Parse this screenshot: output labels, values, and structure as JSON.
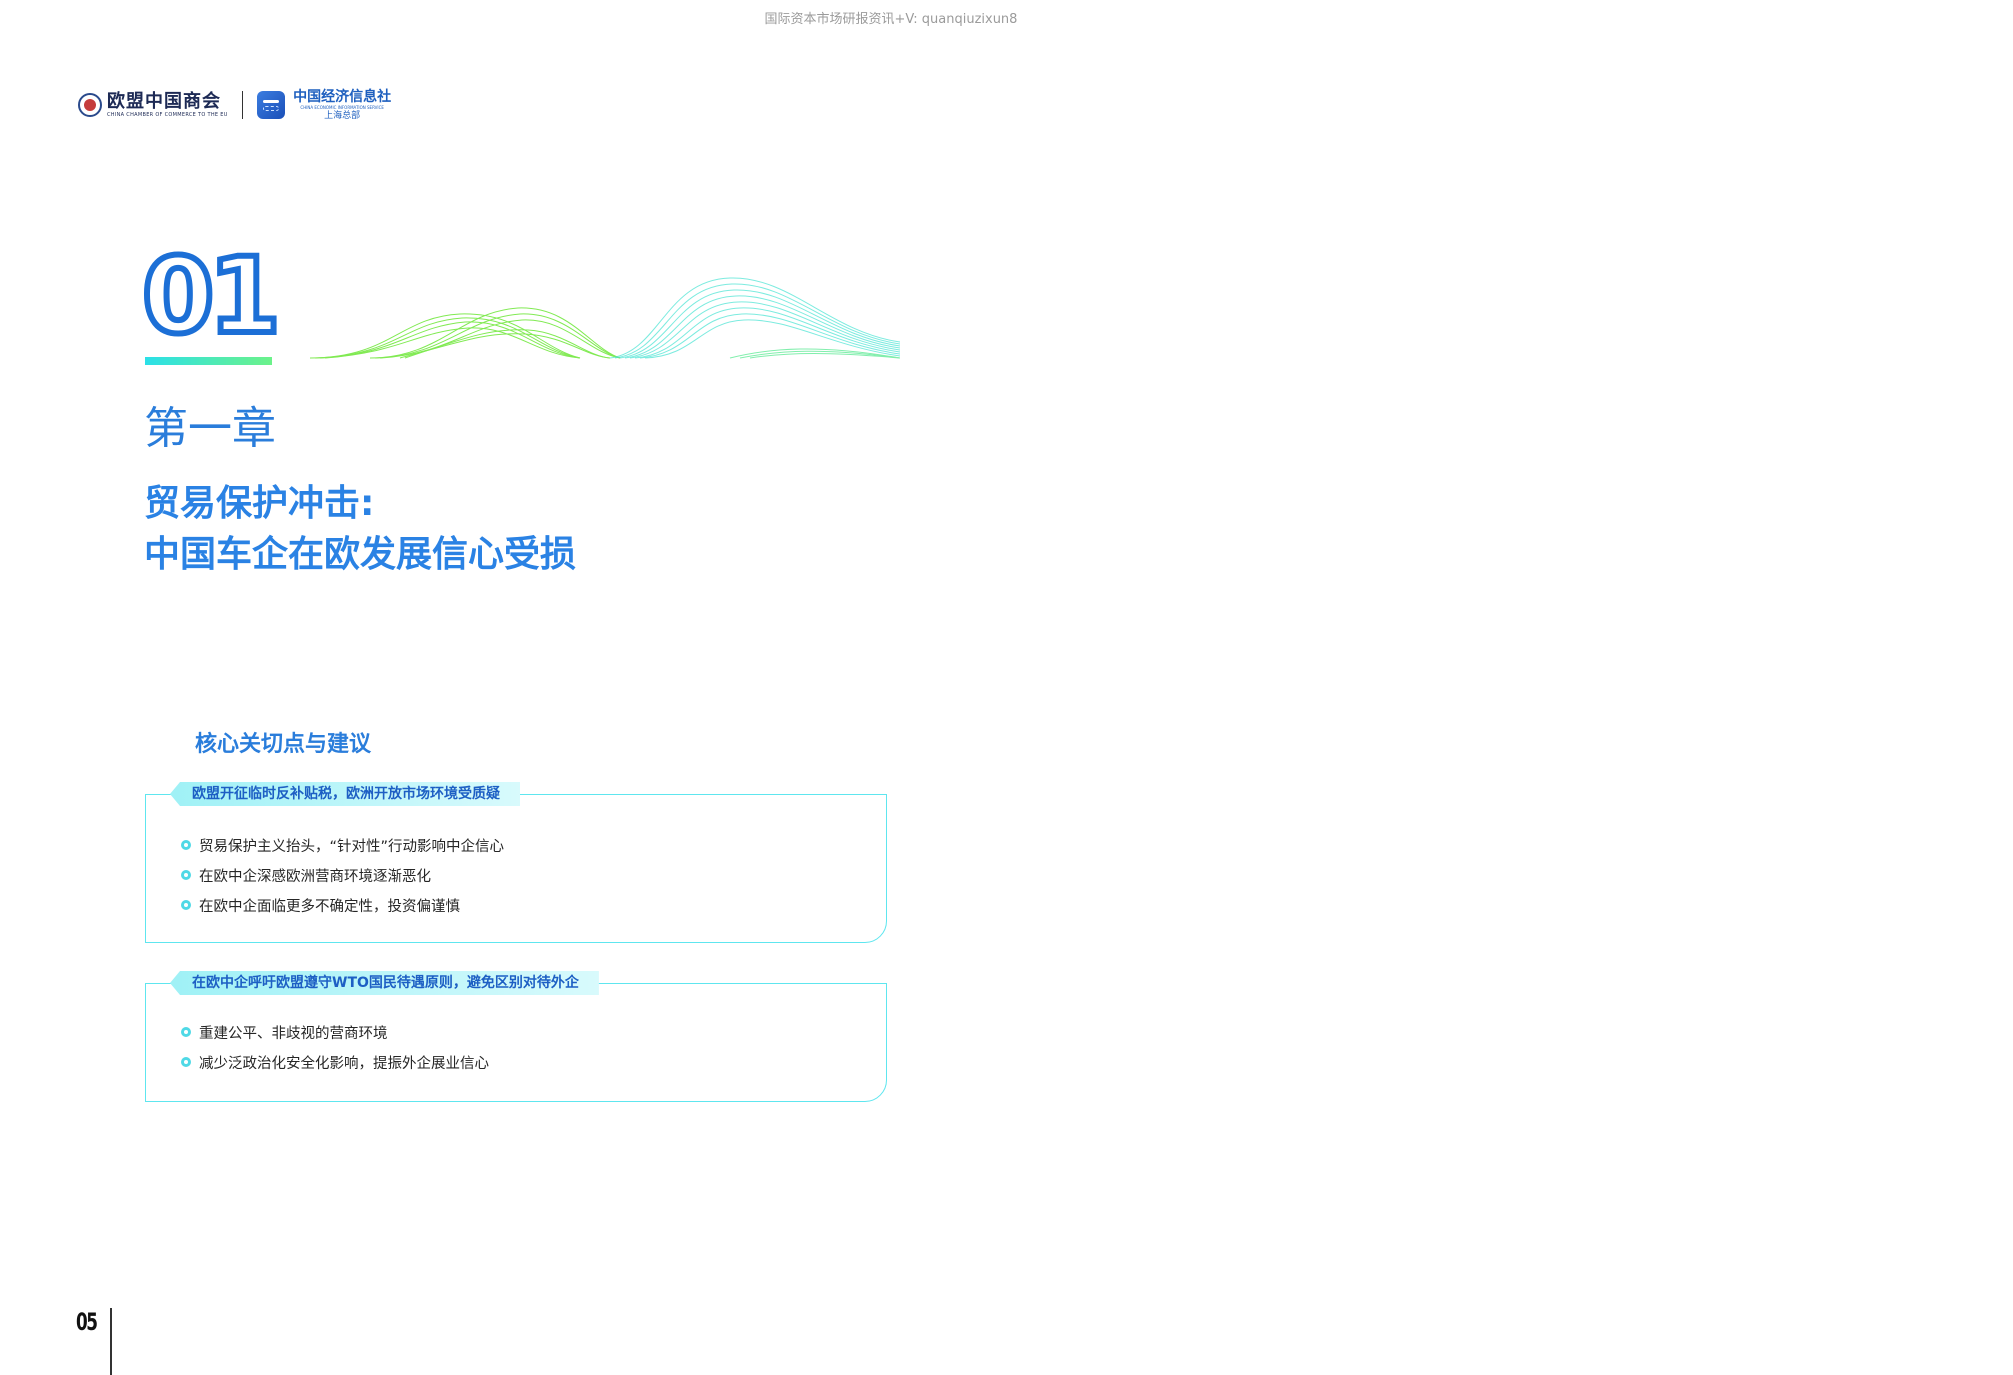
{
  "watermark": "国际资本市场研报资讯+V: quanqiuzixun8",
  "logos": {
    "org1_name": "欧盟中国商会",
    "org1_sub": "CHINA CHAMBER OF COMMERCE TO THE EU",
    "org2_name": "中国经济信息社",
    "org2_sub": "CHINA ECONOMIC INFORMATION SERVICE",
    "org2_sub2": "上海总部"
  },
  "chapter": {
    "number": "01",
    "label": "第一章",
    "title_lines": [
      "贸易保护冲击:",
      "中国车企在欧发展信心受损"
    ]
  },
  "key_points": {
    "heading": "核心关切点与建议",
    "boxes": [
      {
        "title": "欧盟开征临时反补贴税，欧洲开放市场环境受质疑",
        "items": [
          "贸易保护主义抬头，“针对性”行动影响中企信心",
          "在欧中企深感欧洲营商环境逐渐恶化",
          "在欧中企面临更多不确定性，投资偏谨慎"
        ]
      },
      {
        "title": "在欧中企呼吁欧盟遵守WTO国民待遇原则，避免区别对待外企",
        "items": [
          "重建公平、非歧视的营商环境",
          "减少泛政治化安全化影响，提振外企展业信心"
        ]
      }
    ]
  },
  "page_number": "05",
  "colors": {
    "primary_blue": "#2a7ddb",
    "cyan": "#5ee6ef",
    "green": "#7be81e"
  }
}
